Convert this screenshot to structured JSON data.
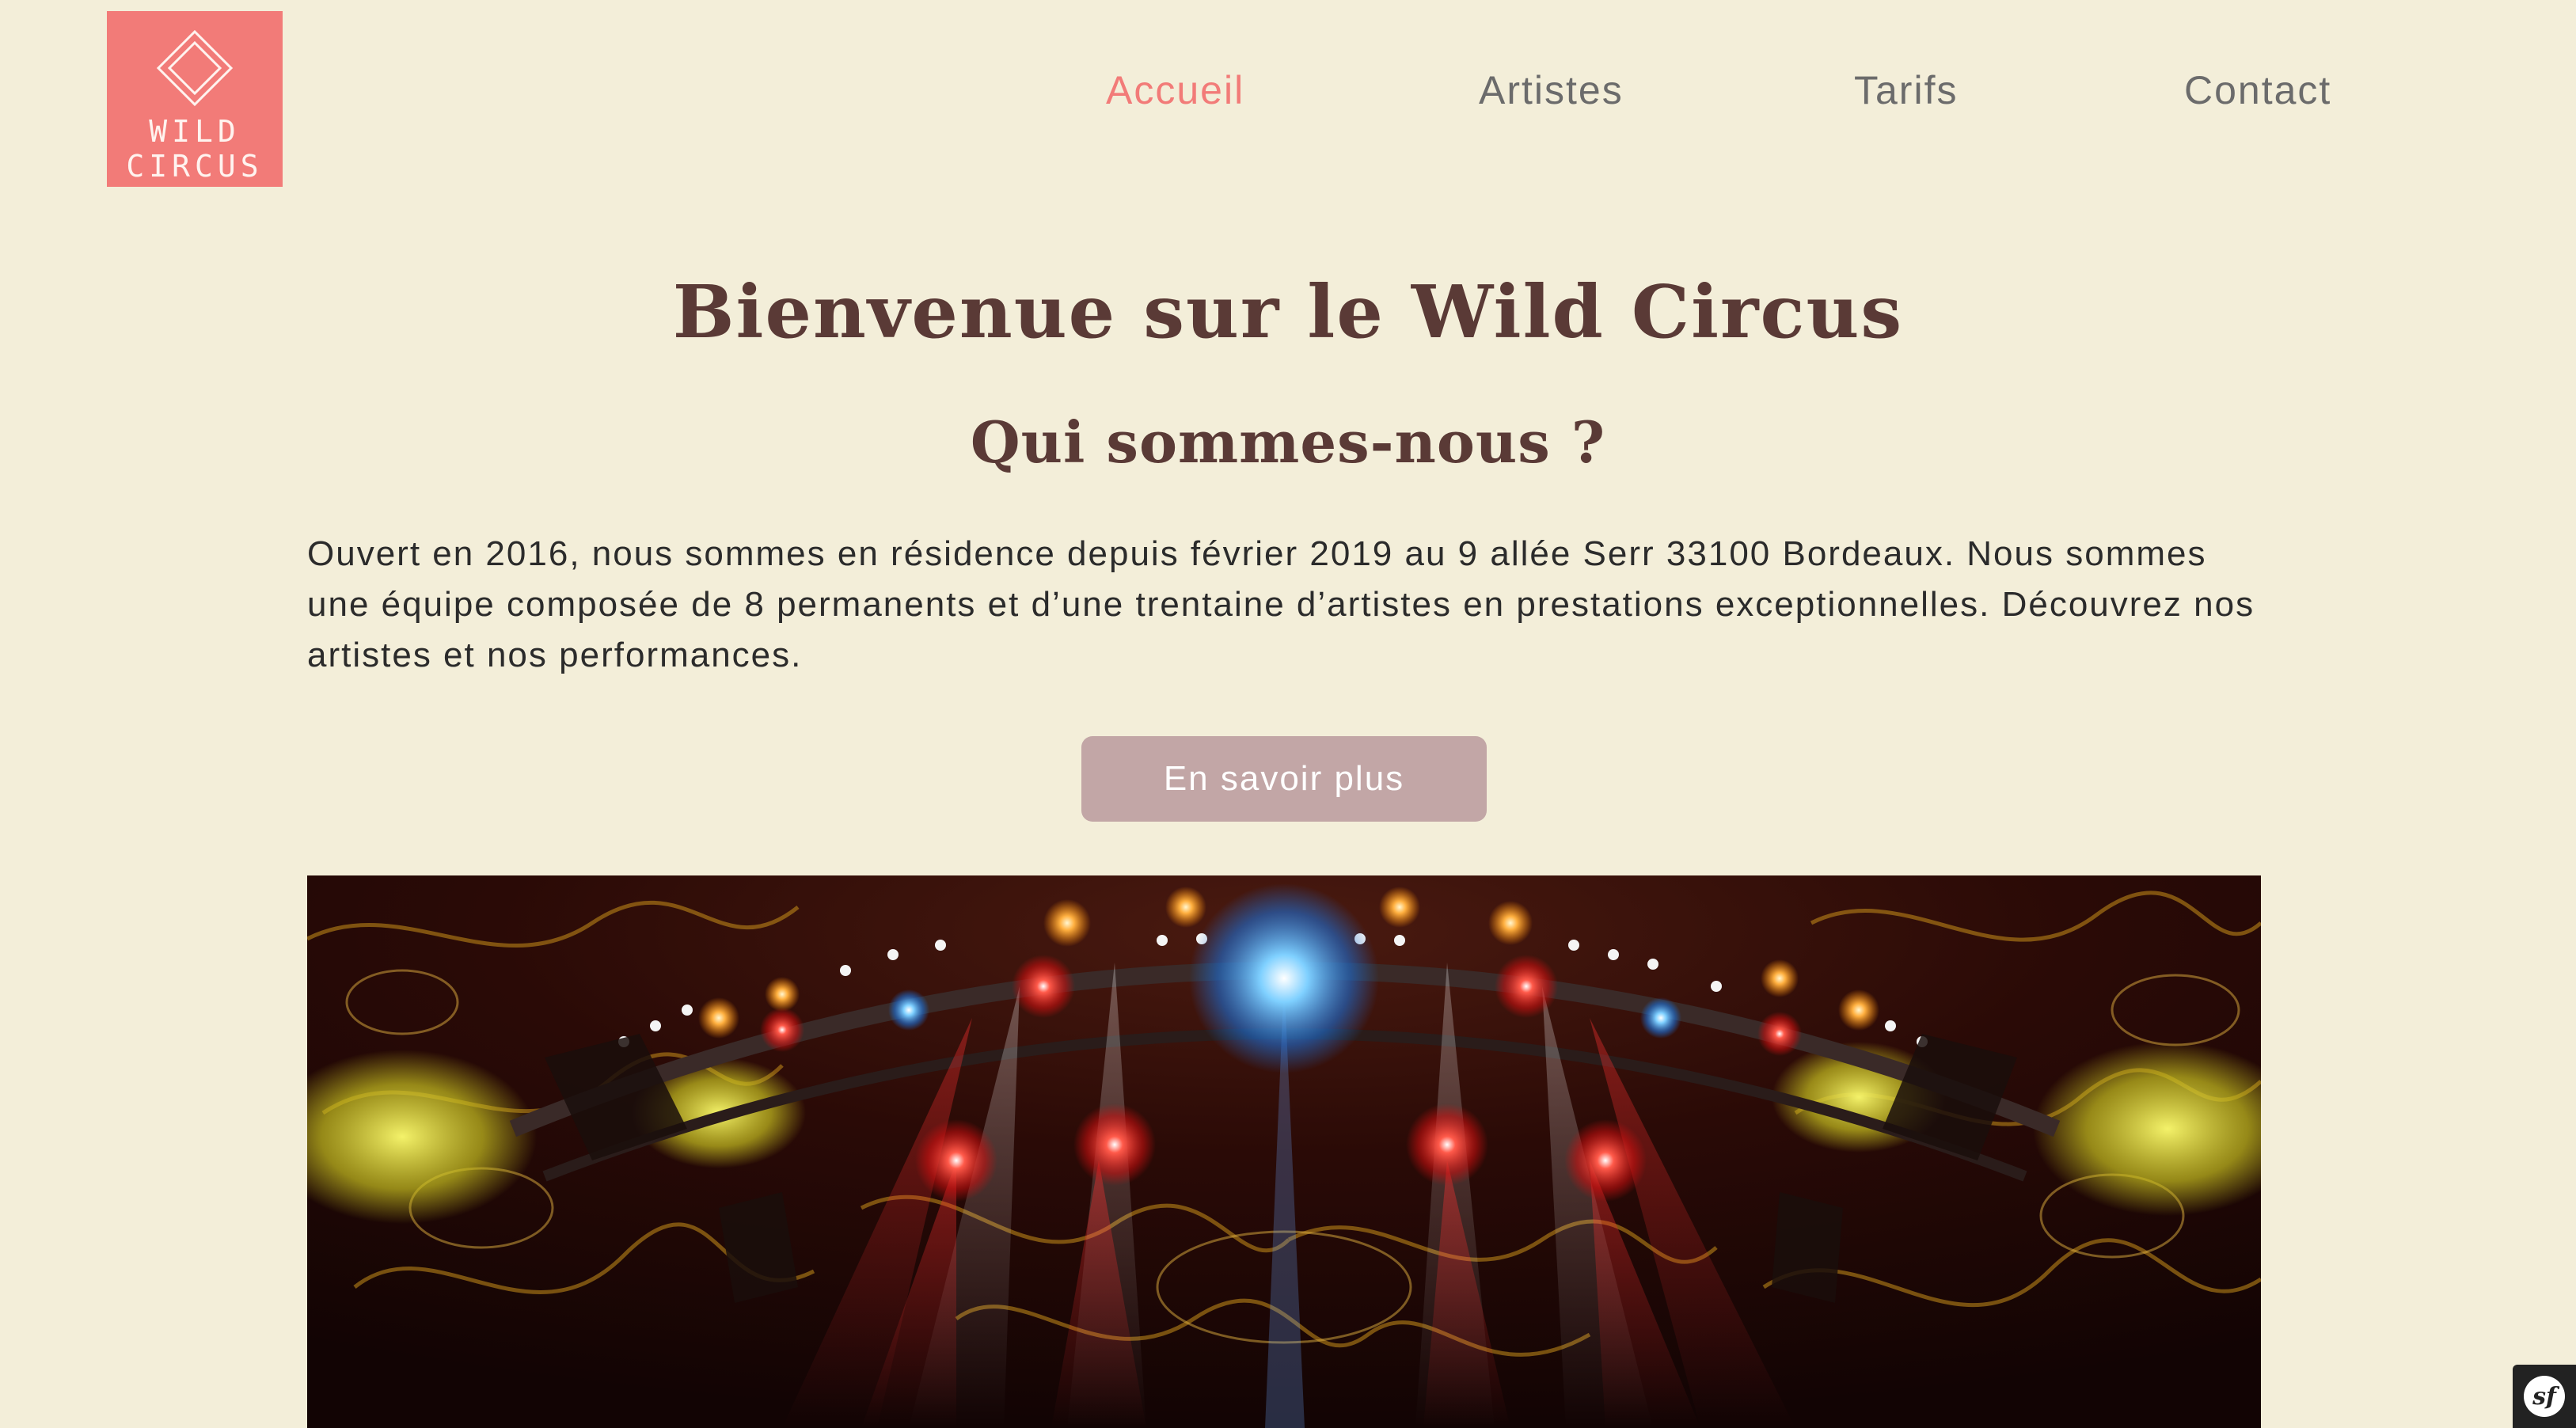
{
  "brand": {
    "logo_line1": "WILD",
    "logo_line2": "CIRCUS",
    "logo_color": "#f27b78"
  },
  "nav": {
    "items": [
      {
        "label": "Accueil",
        "active": true
      },
      {
        "label": "Artistes",
        "active": false
      },
      {
        "label": "Tarifs",
        "active": false
      },
      {
        "label": "Contact",
        "active": false
      }
    ],
    "active_color": "#f27b78",
    "inactive_color": "#6b6b6b"
  },
  "main": {
    "title": "Bienvenue sur le Wild Circus",
    "subtitle": "Qui sommes-nous ?",
    "intro": "Ouvert en 2016, nous sommes en résidence depuis février 2019 au 9 allée Serr 33100 Bordeaux. Nous sommes une équipe composée de 8 permanents et d’une trentaine d’artistes en prestations exceptionnelles. Découvrez nos artistes et nos performances.",
    "cta_label": "En savoir plus",
    "cta_color": "#c2a6a6",
    "hero_image": "circus-stage-lights"
  },
  "page": {
    "background": "#f3eed9",
    "text_color": "#2b2b2b",
    "heading_color": "#5a3a36"
  },
  "debug_toolbar": {
    "icon": "symfony-icon",
    "glyph": "sf"
  }
}
